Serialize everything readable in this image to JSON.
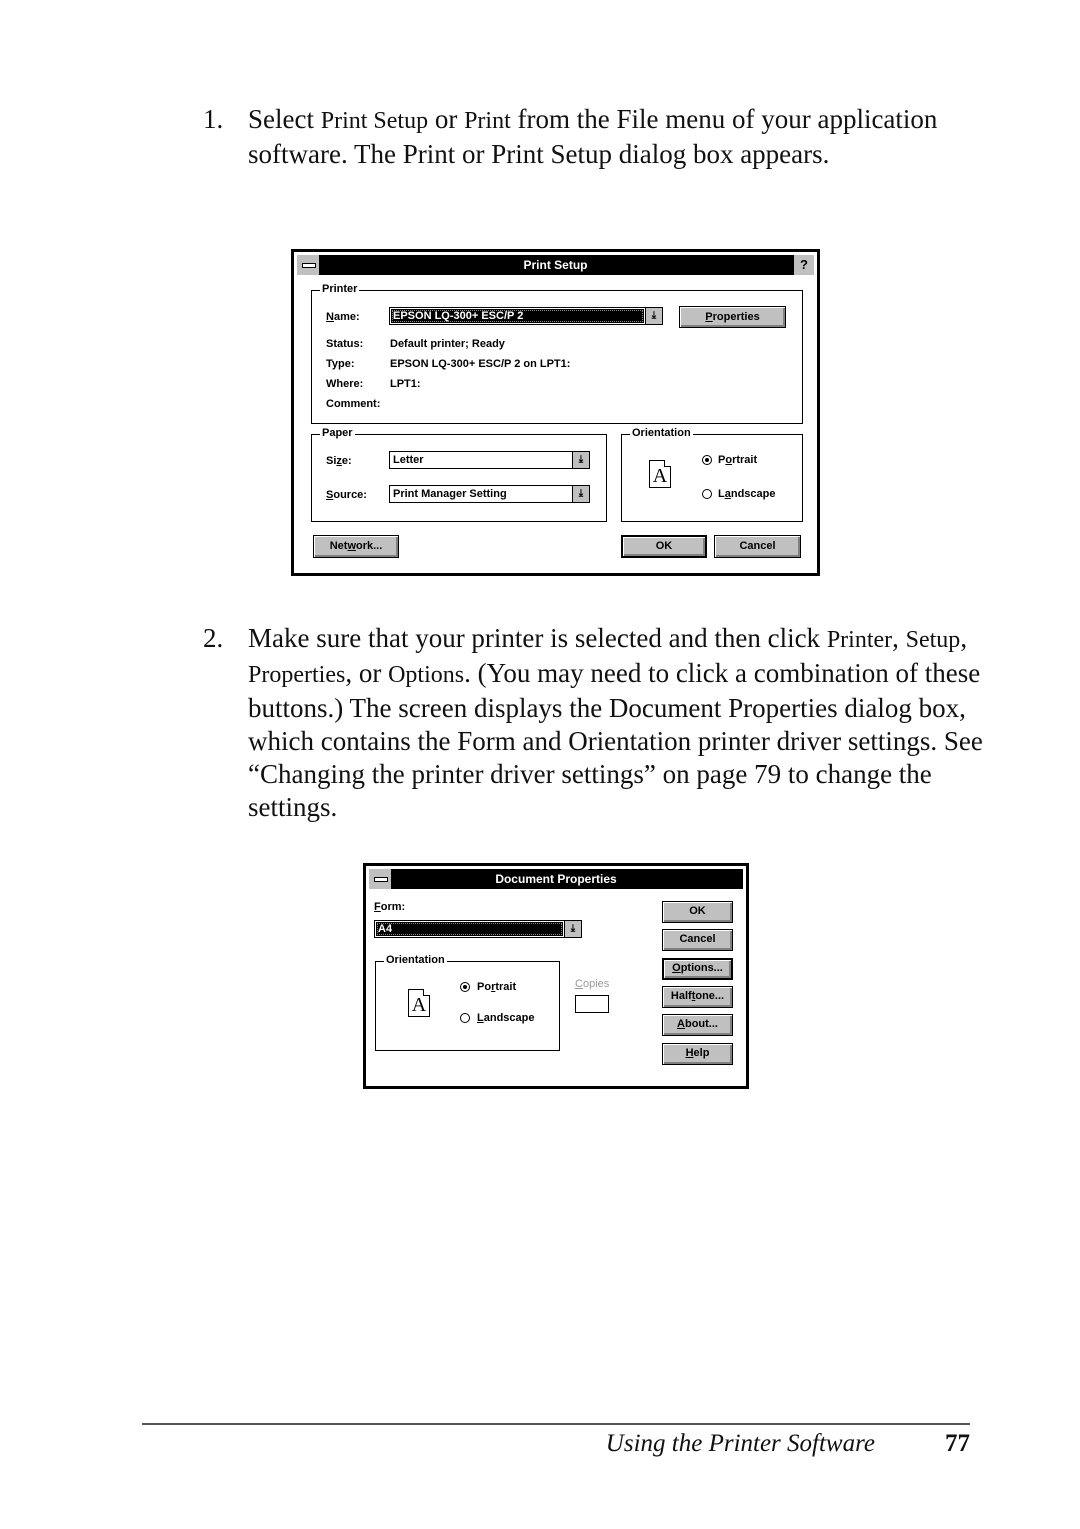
{
  "steps": [
    {
      "number": "1.",
      "text_parts": [
        "Select ",
        "Print Setup",
        " or ",
        "Print",
        " from the File menu of your application software. The Print or Print Setup dialog box appears."
      ]
    },
    {
      "number": "2.",
      "text_parts": [
        "Make sure that your printer is selected and then click ",
        "Printer",
        ", ",
        "Setup",
        ", ",
        "Properties",
        ", or ",
        "Options",
        ". (You may need to click a combination of these buttons.) The screen displays the Document Properties dialog box, which contains the Form and Orientation printer driver settings. See “Changing the printer driver settings” on page 79 to change the settings."
      ]
    }
  ],
  "print_setup": {
    "title": "Print Setup",
    "help": "?",
    "printer_group": "Printer",
    "name_label_u": "N",
    "name_label_rest": "ame:",
    "name_value": "EPSON LQ-300+ ESC/P 2",
    "properties_u": "P",
    "properties_rest": "roperties",
    "status_label": "Status:",
    "status_value": "Default printer; Ready",
    "type_label": "Type:",
    "type_value": "EPSON LQ-300+ ESC/P 2 on LPT1:",
    "where_label": "Where:",
    "where_value": "LPT1:",
    "comment_label": "Comment:",
    "comment_value": "",
    "paper_group": "Paper",
    "size_label_a": "Si",
    "size_label_u": "z",
    "size_label_b": "e:",
    "size_value": "Letter",
    "source_label_u": "S",
    "source_label_rest": "ource:",
    "source_value": "Print Manager Setting",
    "orientation_group": "Orientation",
    "page_glyph": "A",
    "portrait_a": "P",
    "portrait_u": "o",
    "portrait_b": "rtrait",
    "landscape_a": "L",
    "landscape_u": "a",
    "landscape_b": "ndscape",
    "orientation_selected": "Portrait",
    "network_a": "Net",
    "network_u": "w",
    "network_b": "ork...",
    "ok": "OK",
    "cancel": "Cancel",
    "dropdown_arrow": "⤓"
  },
  "doc_props": {
    "title": "Document Properties",
    "form_label_u": "F",
    "form_label_rest": "orm:",
    "form_value": "A4",
    "orientation_group": "Orientation",
    "page_glyph": "A",
    "portrait_a": "Po",
    "portrait_u": "r",
    "portrait_b": "trait",
    "landscape_u": "L",
    "landscape_rest": "andscape",
    "orientation_selected": "Portrait",
    "copies_u": "C",
    "copies_rest": "opies",
    "copies_value": "",
    "ok": "OK",
    "cancel": "Cancel",
    "options_u": "O",
    "options_rest": "ptions...",
    "halftone_a": "Half",
    "halftone_u": "t",
    "halftone_b": "one...",
    "about_u": "A",
    "about_rest": "bout...",
    "help_u": "H",
    "help_rest": "elp",
    "dropdown_arrow": "⤓"
  },
  "footer": {
    "section_title": "Using the Printer Software",
    "page_number": "77"
  }
}
